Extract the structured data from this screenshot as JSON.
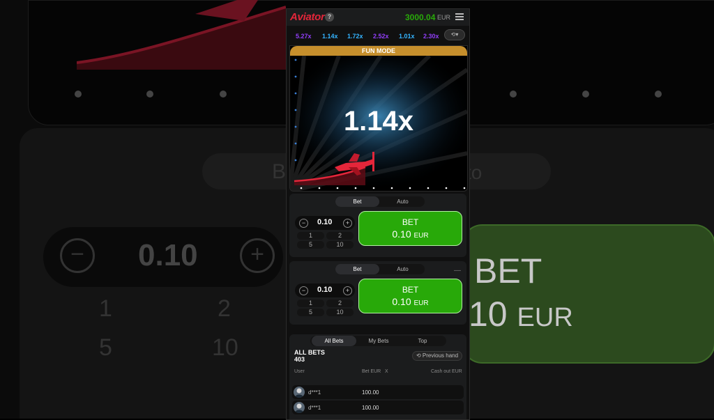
{
  "header": {
    "logo": "Aviator",
    "help": "?",
    "balance": "3000.04",
    "currency": "EUR"
  },
  "multipliers": [
    {
      "value": "5.27x",
      "color": "#913ef8"
    },
    {
      "value": "1.14x",
      "color": "#34b4ff"
    },
    {
      "value": "1.72x",
      "color": "#34b4ff"
    },
    {
      "value": "2.52x",
      "color": "#913ef8"
    },
    {
      "value": "1.01x",
      "color": "#34b4ff"
    },
    {
      "value": "2.30x",
      "color": "#913ef8"
    }
  ],
  "game": {
    "mode": "FUN MODE",
    "multiplier": "1.14x"
  },
  "bet_panels": [
    {
      "tabs": [
        "Bet",
        "Auto"
      ],
      "amount": "0.10",
      "quick": [
        "1",
        "2",
        "5",
        "10"
      ],
      "button_label": "BET",
      "button_amount": "0.10",
      "button_currency": "EUR",
      "more": ""
    },
    {
      "tabs": [
        "Bet",
        "Auto"
      ],
      "amount": "0.10",
      "quick": [
        "1",
        "2",
        "5",
        "10"
      ],
      "button_label": "BET",
      "button_amount": "0.10",
      "button_currency": "EUR",
      "more": "—"
    }
  ],
  "bets": {
    "tabs": [
      "All Bets",
      "My Bets",
      "Top"
    ],
    "title": "ALL BETS",
    "count": "403",
    "previous_hand": "Previous hand",
    "columns": [
      "User",
      "Bet EUR",
      "X",
      "Cash out EUR"
    ],
    "rows": [
      {
        "user": "d***1",
        "bet": "100.00"
      },
      {
        "user": "d***1",
        "bet": "100.00"
      }
    ]
  },
  "background": {
    "tabs": [
      "Be",
      "to"
    ],
    "amount": "0.10",
    "quick": [
      "1",
      "2",
      "5",
      "10"
    ],
    "button_label": "BET",
    "button_amount": "10",
    "button_currency": "EUR"
  },
  "colors": {
    "accent_red": "#e4263a",
    "bet_green": "#28a909",
    "fun_mode_gold": "#c68f2c"
  }
}
